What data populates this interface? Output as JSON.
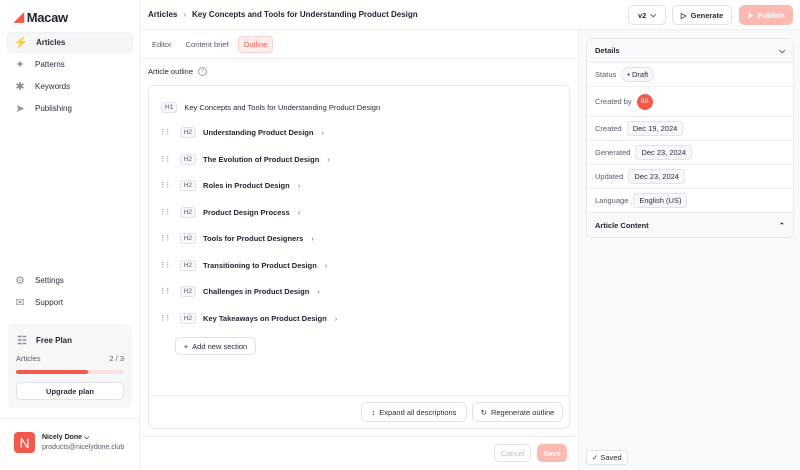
{
  "brand": {
    "name": "Macaw",
    "color": "#f2594b"
  },
  "sidebar": {
    "items": [
      {
        "label": "Articles",
        "icon": "bolt-icon"
      },
      {
        "label": "Patterns",
        "icon": "sparkles-icon"
      },
      {
        "label": "Keywords",
        "icon": "asterisk-icon"
      },
      {
        "label": "Publishing",
        "icon": "send-icon"
      }
    ],
    "bottom": [
      {
        "label": "Settings",
        "icon": "gear-icon"
      },
      {
        "label": "Support",
        "icon": "support-icon"
      }
    ],
    "plan": {
      "title": "Free Plan",
      "label": "Articles",
      "count": "2 / 3",
      "progress": 0.67,
      "upgrade": "Upgrade plan"
    },
    "user": {
      "initial": "N",
      "name": "Nicely Done",
      "email": "products@nicelydone.club"
    }
  },
  "header": {
    "breadcrumb": [
      "Articles",
      "Key Concepts and Tools for Understanding Product Design"
    ],
    "version": "v2",
    "generate": "Generate",
    "publish": "Publish"
  },
  "tabs": [
    "Editor",
    "Content brief",
    "Outline"
  ],
  "outline": {
    "label": "Article outline",
    "h1": {
      "tag": "H1",
      "text": "Key Concepts and Tools for Understanding Product Design"
    },
    "sections": [
      {
        "tag": "H2",
        "text": "Understanding Product Design"
      },
      {
        "tag": "H2",
        "text": "The Evolution of Product Design"
      },
      {
        "tag": "H2",
        "text": "Roles in Product Design"
      },
      {
        "tag": "H2",
        "text": "Product Design Process"
      },
      {
        "tag": "H2",
        "text": "Tools for Product Designers"
      },
      {
        "tag": "H2",
        "text": "Transitioning to Product Design"
      },
      {
        "tag": "H2",
        "text": "Challenges in Product Design"
      },
      {
        "tag": "H2",
        "text": "Key Takeaways on Product Design"
      }
    ],
    "add": "Add new section",
    "expand": "Expand all descriptions",
    "regenerate": "Regenerate outline"
  },
  "footer": {
    "cancel": "Cancel",
    "save": "Save",
    "saved": "Saved"
  },
  "details": {
    "title": "Details",
    "status_label": "Status",
    "status": "Draft",
    "created_by_label": "Created by",
    "created_by": "BB",
    "created_label": "Created",
    "created": "Dec 19, 2024",
    "generated_label": "Generated",
    "generated": "Dec 23, 2024",
    "updated_label": "Updated",
    "updated": "Dec 23, 2024",
    "language_label": "Language",
    "language": "English (US)",
    "article_content": "Article Content"
  }
}
